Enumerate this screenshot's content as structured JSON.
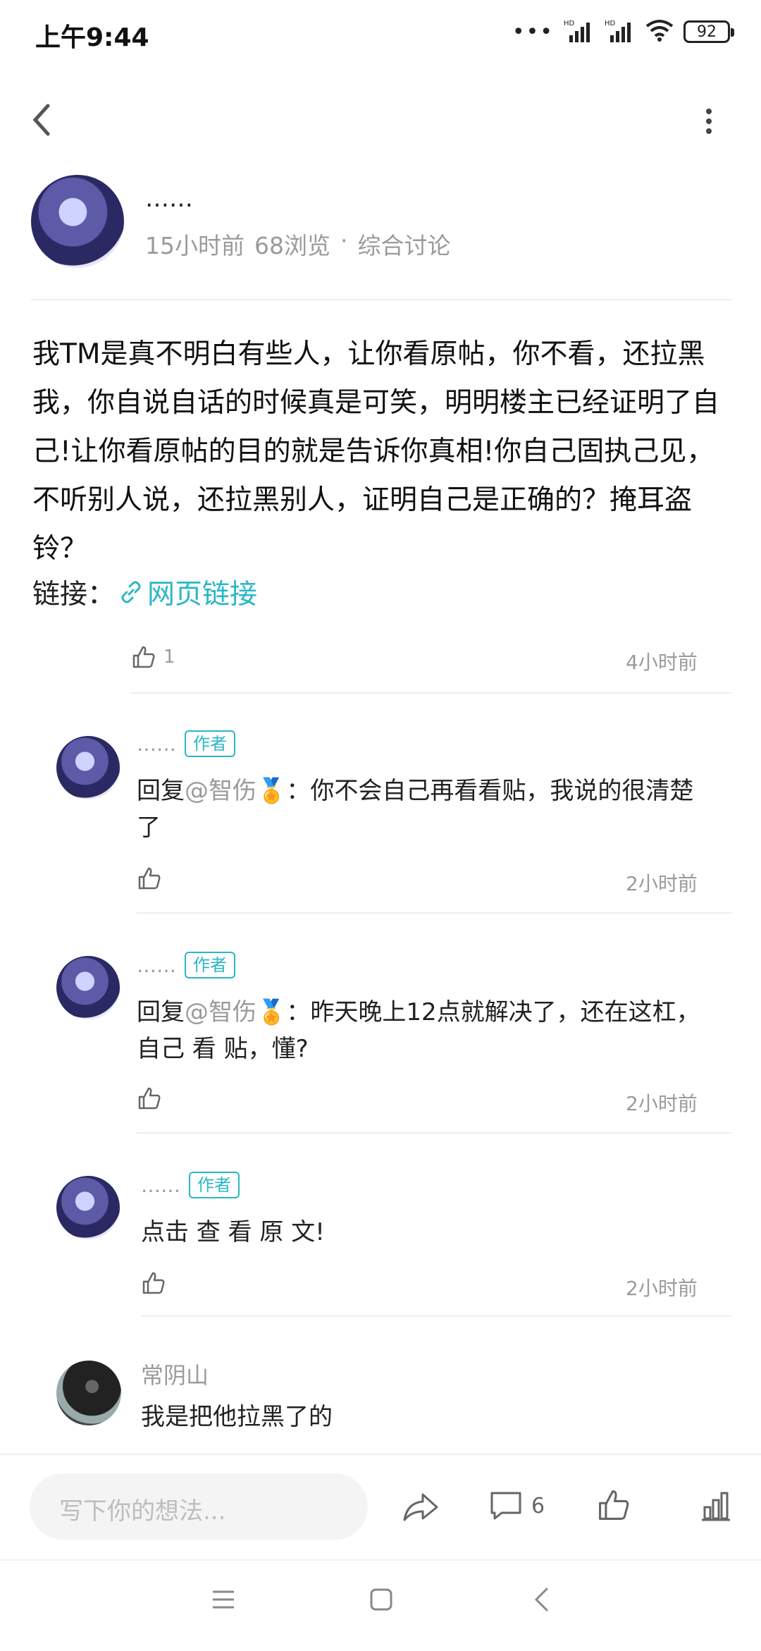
{
  "status": {
    "time": "上午9:44",
    "battery": "92",
    "hd1": "HD",
    "hd2": "HD"
  },
  "post": {
    "author": "……",
    "time": "15小时前",
    "views": "68浏览",
    "dot": "·",
    "category": "综合讨论",
    "body": "我TM是真不明白有些人，让你看原帖，你不看，还拉黑我，你自说自话的时候真是可笑，明明楼主已经证明了自己!让你看原帖的目的就是告诉你真相!你自己固执己见，不听别人说，还拉黑别人，证明自己是正确的？掩耳盗铃？",
    "link_label": "链接：",
    "link_text": "网页链接",
    "likes": "1",
    "reply_time": "4小时前"
  },
  "replies": [
    {
      "author": "……",
      "badge": "作者",
      "prefix": "回复",
      "mention": "@智伤",
      "medal": "🏅",
      "text": "：你不会自己再看看贴，我说的很清楚了",
      "time": "2小时前"
    },
    {
      "author": "……",
      "badge": "作者",
      "prefix": "回复",
      "mention": "@智伤",
      "medal": "🏅",
      "text": "：昨天晚上12点就解决了，还在这杠，自己 看 贴，懂?",
      "time": "2小时前"
    },
    {
      "author": "……",
      "badge": "作者",
      "prefix": "",
      "mention": "",
      "medal": "",
      "text": "点击 查 看 原 文!",
      "time": "2小时前"
    },
    {
      "author": "常阴山",
      "badge": "",
      "prefix": "",
      "mention": "",
      "medal": "",
      "text": "我是把他拉黑了的",
      "time": ""
    }
  ],
  "bottom": {
    "placeholder": "写下你的想法...",
    "comment_count": "6"
  },
  "icons": {
    "back": "back-arrow-icon",
    "more": "more-vertical-icon",
    "link": "link-icon",
    "like": "thumbs-up-icon",
    "share": "share-icon",
    "comment": "comment-icon",
    "stats": "bar-chart-icon"
  }
}
